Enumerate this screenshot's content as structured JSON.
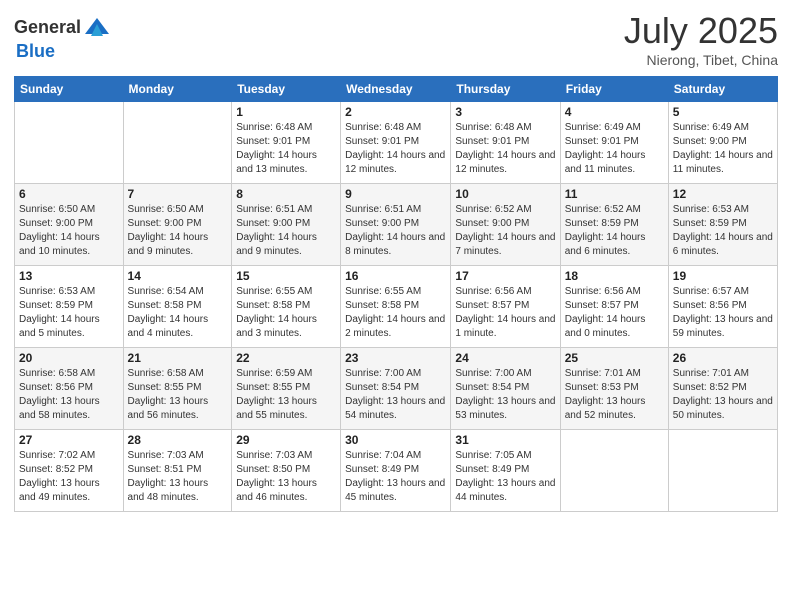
{
  "header": {
    "logo_general": "General",
    "logo_blue": "Blue",
    "month_title": "July 2025",
    "location": "Nierong, Tibet, China"
  },
  "days_of_week": [
    "Sunday",
    "Monday",
    "Tuesday",
    "Wednesday",
    "Thursday",
    "Friday",
    "Saturday"
  ],
  "weeks": [
    [
      {
        "day": "",
        "sunrise": "",
        "sunset": "",
        "daylight": ""
      },
      {
        "day": "",
        "sunrise": "",
        "sunset": "",
        "daylight": ""
      },
      {
        "day": "1",
        "sunrise": "Sunrise: 6:48 AM",
        "sunset": "Sunset: 9:01 PM",
        "daylight": "Daylight: 14 hours and 13 minutes."
      },
      {
        "day": "2",
        "sunrise": "Sunrise: 6:48 AM",
        "sunset": "Sunset: 9:01 PM",
        "daylight": "Daylight: 14 hours and 12 minutes."
      },
      {
        "day": "3",
        "sunrise": "Sunrise: 6:48 AM",
        "sunset": "Sunset: 9:01 PM",
        "daylight": "Daylight: 14 hours and 12 minutes."
      },
      {
        "day": "4",
        "sunrise": "Sunrise: 6:49 AM",
        "sunset": "Sunset: 9:01 PM",
        "daylight": "Daylight: 14 hours and 11 minutes."
      },
      {
        "day": "5",
        "sunrise": "Sunrise: 6:49 AM",
        "sunset": "Sunset: 9:00 PM",
        "daylight": "Daylight: 14 hours and 11 minutes."
      }
    ],
    [
      {
        "day": "6",
        "sunrise": "Sunrise: 6:50 AM",
        "sunset": "Sunset: 9:00 PM",
        "daylight": "Daylight: 14 hours and 10 minutes."
      },
      {
        "day": "7",
        "sunrise": "Sunrise: 6:50 AM",
        "sunset": "Sunset: 9:00 PM",
        "daylight": "Daylight: 14 hours and 9 minutes."
      },
      {
        "day": "8",
        "sunrise": "Sunrise: 6:51 AM",
        "sunset": "Sunset: 9:00 PM",
        "daylight": "Daylight: 14 hours and 9 minutes."
      },
      {
        "day": "9",
        "sunrise": "Sunrise: 6:51 AM",
        "sunset": "Sunset: 9:00 PM",
        "daylight": "Daylight: 14 hours and 8 minutes."
      },
      {
        "day": "10",
        "sunrise": "Sunrise: 6:52 AM",
        "sunset": "Sunset: 9:00 PM",
        "daylight": "Daylight: 14 hours and 7 minutes."
      },
      {
        "day": "11",
        "sunrise": "Sunrise: 6:52 AM",
        "sunset": "Sunset: 8:59 PM",
        "daylight": "Daylight: 14 hours and 6 minutes."
      },
      {
        "day": "12",
        "sunrise": "Sunrise: 6:53 AM",
        "sunset": "Sunset: 8:59 PM",
        "daylight": "Daylight: 14 hours and 6 minutes."
      }
    ],
    [
      {
        "day": "13",
        "sunrise": "Sunrise: 6:53 AM",
        "sunset": "Sunset: 8:59 PM",
        "daylight": "Daylight: 14 hours and 5 minutes."
      },
      {
        "day": "14",
        "sunrise": "Sunrise: 6:54 AM",
        "sunset": "Sunset: 8:58 PM",
        "daylight": "Daylight: 14 hours and 4 minutes."
      },
      {
        "day": "15",
        "sunrise": "Sunrise: 6:55 AM",
        "sunset": "Sunset: 8:58 PM",
        "daylight": "Daylight: 14 hours and 3 minutes."
      },
      {
        "day": "16",
        "sunrise": "Sunrise: 6:55 AM",
        "sunset": "Sunset: 8:58 PM",
        "daylight": "Daylight: 14 hours and 2 minutes."
      },
      {
        "day": "17",
        "sunrise": "Sunrise: 6:56 AM",
        "sunset": "Sunset: 8:57 PM",
        "daylight": "Daylight: 14 hours and 1 minute."
      },
      {
        "day": "18",
        "sunrise": "Sunrise: 6:56 AM",
        "sunset": "Sunset: 8:57 PM",
        "daylight": "Daylight: 14 hours and 0 minutes."
      },
      {
        "day": "19",
        "sunrise": "Sunrise: 6:57 AM",
        "sunset": "Sunset: 8:56 PM",
        "daylight": "Daylight: 13 hours and 59 minutes."
      }
    ],
    [
      {
        "day": "20",
        "sunrise": "Sunrise: 6:58 AM",
        "sunset": "Sunset: 8:56 PM",
        "daylight": "Daylight: 13 hours and 58 minutes."
      },
      {
        "day": "21",
        "sunrise": "Sunrise: 6:58 AM",
        "sunset": "Sunset: 8:55 PM",
        "daylight": "Daylight: 13 hours and 56 minutes."
      },
      {
        "day": "22",
        "sunrise": "Sunrise: 6:59 AM",
        "sunset": "Sunset: 8:55 PM",
        "daylight": "Daylight: 13 hours and 55 minutes."
      },
      {
        "day": "23",
        "sunrise": "Sunrise: 7:00 AM",
        "sunset": "Sunset: 8:54 PM",
        "daylight": "Daylight: 13 hours and 54 minutes."
      },
      {
        "day": "24",
        "sunrise": "Sunrise: 7:00 AM",
        "sunset": "Sunset: 8:54 PM",
        "daylight": "Daylight: 13 hours and 53 minutes."
      },
      {
        "day": "25",
        "sunrise": "Sunrise: 7:01 AM",
        "sunset": "Sunset: 8:53 PM",
        "daylight": "Daylight: 13 hours and 52 minutes."
      },
      {
        "day": "26",
        "sunrise": "Sunrise: 7:01 AM",
        "sunset": "Sunset: 8:52 PM",
        "daylight": "Daylight: 13 hours and 50 minutes."
      }
    ],
    [
      {
        "day": "27",
        "sunrise": "Sunrise: 7:02 AM",
        "sunset": "Sunset: 8:52 PM",
        "daylight": "Daylight: 13 hours and 49 minutes."
      },
      {
        "day": "28",
        "sunrise": "Sunrise: 7:03 AM",
        "sunset": "Sunset: 8:51 PM",
        "daylight": "Daylight: 13 hours and 48 minutes."
      },
      {
        "day": "29",
        "sunrise": "Sunrise: 7:03 AM",
        "sunset": "Sunset: 8:50 PM",
        "daylight": "Daylight: 13 hours and 46 minutes."
      },
      {
        "day": "30",
        "sunrise": "Sunrise: 7:04 AM",
        "sunset": "Sunset: 8:49 PM",
        "daylight": "Daylight: 13 hours and 45 minutes."
      },
      {
        "day": "31",
        "sunrise": "Sunrise: 7:05 AM",
        "sunset": "Sunset: 8:49 PM",
        "daylight": "Daylight: 13 hours and 44 minutes."
      },
      {
        "day": "",
        "sunrise": "",
        "sunset": "",
        "daylight": ""
      },
      {
        "day": "",
        "sunrise": "",
        "sunset": "",
        "daylight": ""
      }
    ]
  ]
}
